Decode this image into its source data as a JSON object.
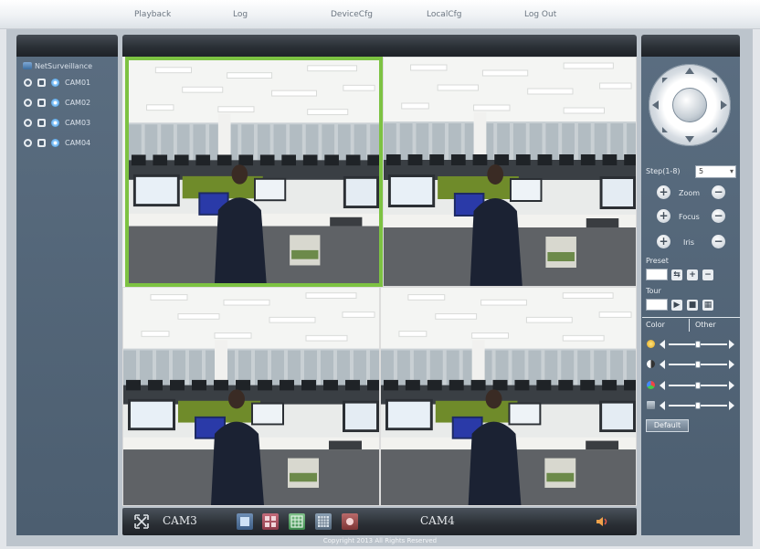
{
  "nav": {
    "items": [
      "Playback",
      "Log",
      "DeviceCfg",
      "LocalCfg",
      "Log Out"
    ]
  },
  "device_tree": {
    "root": "NetSurveillance",
    "cameras": [
      "CAM01",
      "CAM02",
      "CAM03",
      "CAM04"
    ]
  },
  "video": {
    "channels": 4,
    "selected_index": 0
  },
  "toolbar": {
    "left_label": "CAM3",
    "center_label": "CAM4"
  },
  "ptz": {
    "step_label": "Step(1-8)",
    "step_value": "5",
    "zoom_label": "Zoom",
    "focus_label": "Focus",
    "iris_label": "Iris",
    "preset_label": "Preset",
    "tour_label": "Tour"
  },
  "color_panel": {
    "tabs": [
      "Color",
      "Other"
    ],
    "sliders": [
      {
        "icon": "brightness-icon",
        "value": 0.5
      },
      {
        "icon": "contrast-icon",
        "value": 0.5
      },
      {
        "icon": "saturation-icon",
        "value": 0.5
      },
      {
        "icon": "hue-icon",
        "value": 0.5
      }
    ],
    "default_label": "Default"
  },
  "footer": {
    "copyright": "Copyright 2013 All Rights Reserved"
  },
  "colors": {
    "accent_selected": "#7dc242",
    "panel": "#556779",
    "header": "#2b3036"
  }
}
